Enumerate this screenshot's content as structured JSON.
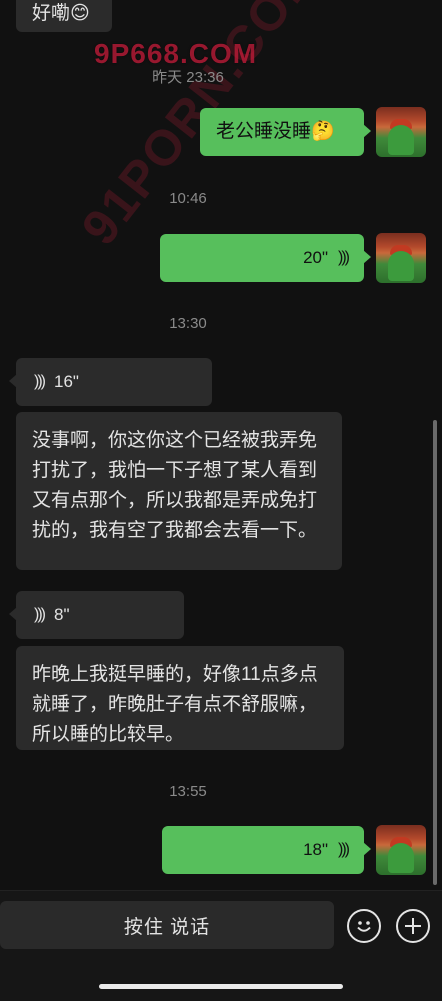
{
  "watermarks": {
    "top": "9P668.COM",
    "diagonal": "91PORN.COM"
  },
  "partial_top_bubble": "好嘞😊",
  "timestamps": [
    "昨天 23:36",
    "10:46",
    "13:30",
    "13:55"
  ],
  "messages": {
    "m1": {
      "sender": "me",
      "text": "老公睡没睡🤔"
    },
    "m2": {
      "sender": "me",
      "duration": "20\""
    },
    "m3": {
      "sender": "other",
      "duration": "16\""
    },
    "m4": {
      "sender": "other",
      "text": "没事啊，你这你这个已经被我弄免打扰了，我怕一下子想了某人看到又有点那个，所以我都是弄成免打扰的，我有空了我都会去看一下。"
    },
    "m5": {
      "sender": "other",
      "duration": "8\""
    },
    "m6": {
      "sender": "other",
      "text": "昨晚上我挺早睡的，好像11点多点就睡了，昨晚肚子有点不舒服嘛，所以睡的比较早。"
    },
    "m7": {
      "sender": "me",
      "duration": "18\""
    }
  },
  "icons": {
    "voice_wave": "voice-wave-icon",
    "emoji": "emoji-icon",
    "plus": "plus-icon",
    "avatar": "avatar"
  },
  "input_bar": {
    "hold_to_talk": "按住 说话"
  },
  "colors": {
    "background": "#111111",
    "my_bubble": "#57bf5c",
    "their_bubble": "#2b2b2b",
    "timestamp": "#8a8a8a"
  }
}
